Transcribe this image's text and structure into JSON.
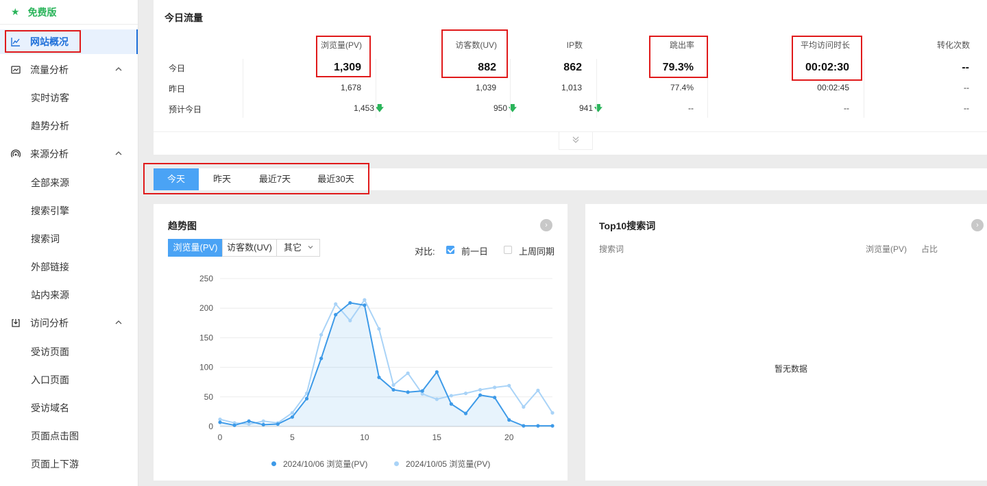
{
  "sidebar": {
    "top_label": "免费版",
    "items": [
      {
        "label": "网站概况",
        "icon": "line-chart-icon"
      },
      {
        "label": "流量分析",
        "icon": "image-chart-icon"
      },
      {
        "label": "实时访客"
      },
      {
        "label": "趋势分析"
      },
      {
        "label": "来源分析",
        "icon": "signal-icon"
      },
      {
        "label": "全部来源"
      },
      {
        "label": "搜索引擎"
      },
      {
        "label": "搜索词"
      },
      {
        "label": "外部链接"
      },
      {
        "label": "站内来源"
      },
      {
        "label": "访问分析",
        "icon": "download-box-icon"
      },
      {
        "label": "受访页面"
      },
      {
        "label": "入口页面"
      },
      {
        "label": "受访域名"
      },
      {
        "label": "页面点击图"
      },
      {
        "label": "页面上下游"
      }
    ]
  },
  "traffic": {
    "title": "今日流量",
    "columns": [
      "浏览量(PV)",
      "访客数(UV)",
      "IP数",
      "跳出率",
      "平均访问时长",
      "转化次数"
    ],
    "rows": [
      {
        "label": "今日",
        "values": [
          "1,309",
          "882",
          "862",
          "79.3%",
          "00:02:30",
          "--"
        ]
      },
      {
        "label": "昨日",
        "values": [
          "1,678",
          "1,039",
          "1,013",
          "77.4%",
          "00:02:45",
          "--"
        ]
      },
      {
        "label": "预计今日",
        "values": [
          "1,453",
          "950",
          "941",
          "--",
          "--",
          "--"
        ]
      }
    ]
  },
  "tabs": [
    "今天",
    "昨天",
    "最近7天",
    "最近30天"
  ],
  "trend": {
    "title": "趋势图",
    "metric_tabs": [
      "浏览量(PV)",
      "访客数(UV)",
      "其它"
    ],
    "compare_label": "对比:",
    "compare_options": [
      {
        "label": "前一日",
        "checked": true
      },
      {
        "label": "上周同期",
        "checked": false
      }
    ]
  },
  "chart_data": {
    "type": "area",
    "x": [
      0,
      1,
      2,
      3,
      4,
      5,
      6,
      7,
      8,
      9,
      10,
      11,
      12,
      13,
      14,
      15,
      16,
      17,
      18,
      19,
      20,
      21,
      22,
      23
    ],
    "xticks": [
      0,
      5,
      10,
      15,
      20
    ],
    "yticks": [
      0,
      50,
      100,
      150,
      200,
      250
    ],
    "ylim": [
      0,
      250
    ],
    "grid": true,
    "legend_position": "bottom",
    "series": [
      {
        "name": "2024/10/06 浏览量(PV)",
        "color": "#3d9ae8",
        "fill": true,
        "values": [
          7,
          2,
          9,
          3,
          4,
          16,
          47,
          115,
          189,
          209,
          205,
          83,
          62,
          58,
          60,
          92,
          38,
          22,
          53,
          49,
          11,
          1,
          1,
          1
        ]
      },
      {
        "name": "2024/10/05 浏览量(PV)",
        "color": "#a9d3f7",
        "fill": false,
        "values": [
          12,
          6,
          4,
          9,
          6,
          23,
          56,
          155,
          207,
          179,
          214,
          165,
          70,
          90,
          55,
          46,
          52,
          56,
          62,
          66,
          69,
          33,
          61,
          23
        ]
      }
    ]
  },
  "top10": {
    "title": "Top10搜索词",
    "columns": [
      "搜索词",
      "浏览量(PV)",
      "占比"
    ],
    "empty_text": "暂无数据"
  }
}
